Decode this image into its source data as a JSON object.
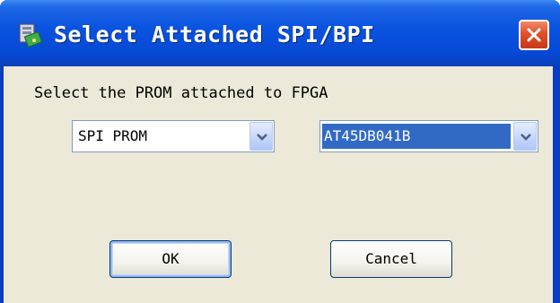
{
  "window": {
    "title": "Select Attached SPI/BPI",
    "icons": {
      "app": "app-icon",
      "close": "close-icon"
    }
  },
  "dialog": {
    "prompt": "Select the PROM attached to FPGA",
    "prom_type": {
      "value": "SPI PROM"
    },
    "device": {
      "value": "AT45DB041B"
    },
    "ok_label": "OK",
    "cancel_label": "Cancel"
  },
  "colors": {
    "titlebar": "#0a54e0",
    "client_bg": "#ece9d8",
    "selection": "#316ac5",
    "close_button": "#e0502a"
  }
}
